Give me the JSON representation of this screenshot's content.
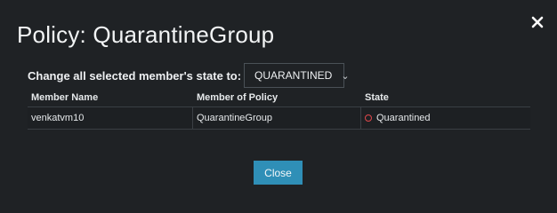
{
  "dialog": {
    "title": "Policy: QuarantineGroup",
    "close_icon": "close-icon"
  },
  "bulk_change": {
    "label": "Change all selected member's state to:",
    "selected_value": "QUARANTINED",
    "chevron_icon": "chevron-down-icon"
  },
  "table": {
    "columns": [
      "Member Name",
      "Member of Policy",
      "State"
    ],
    "rows": [
      {
        "member_name": "venkatvm10",
        "member_of_policy": "QuarantineGroup",
        "state": "Quarantined",
        "state_icon": "circle-status-icon",
        "state_color": "#e0474c"
      }
    ]
  },
  "footer": {
    "close_label": "Close"
  },
  "colors": {
    "background": "#1f2225",
    "accent_button": "#2f8fb7",
    "status_quarantined": "#e0474c"
  }
}
